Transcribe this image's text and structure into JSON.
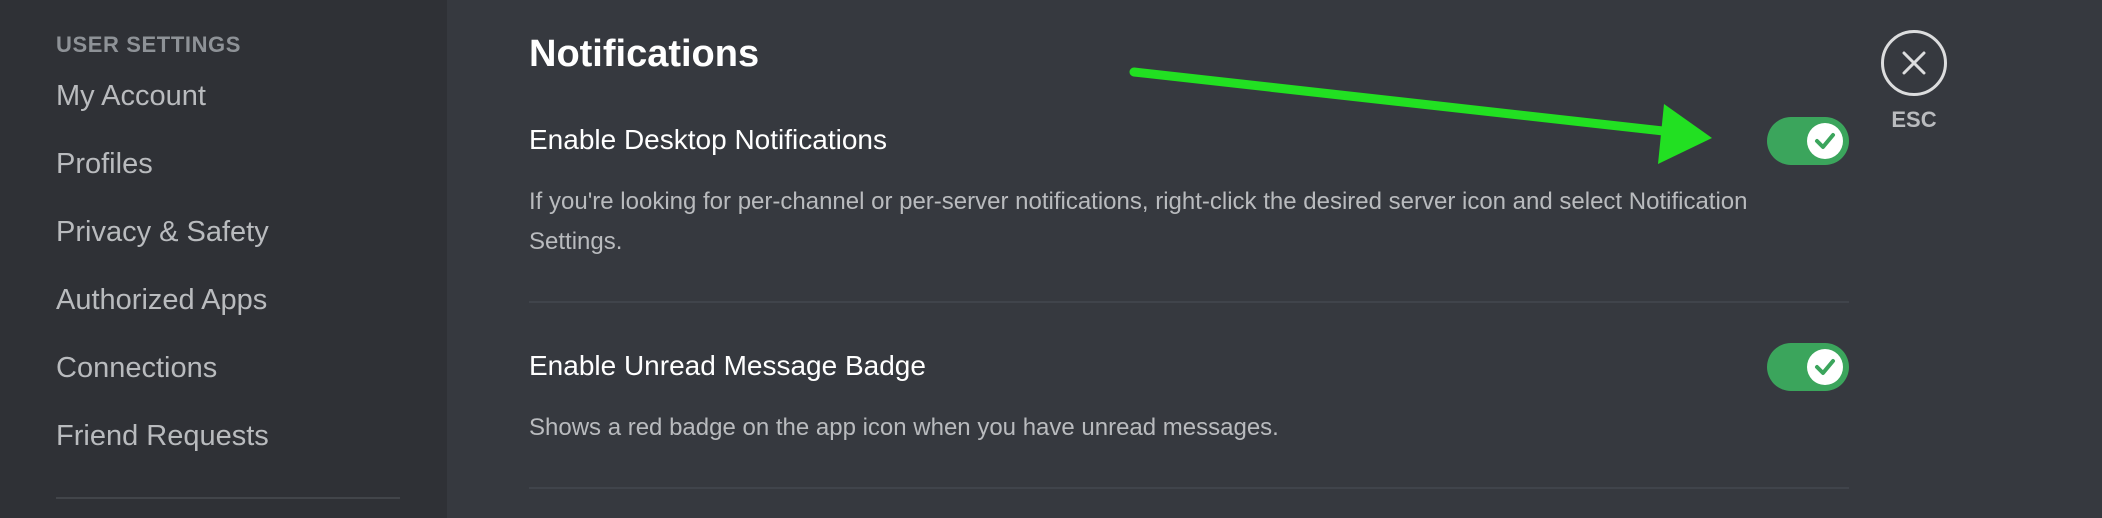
{
  "sidebar": {
    "header": "USER SETTINGS",
    "items": [
      {
        "label": "My Account"
      },
      {
        "label": "Profiles"
      },
      {
        "label": "Privacy & Safety"
      },
      {
        "label": "Authorized Apps"
      },
      {
        "label": "Connections"
      },
      {
        "label": "Friend Requests"
      }
    ]
  },
  "main": {
    "title": "Notifications",
    "settings": [
      {
        "title": "Enable Desktop Notifications",
        "description": "If you're looking for per-channel or per-server notifications, right-click the desired server icon and select Notification Settings.",
        "enabled": true
      },
      {
        "title": "Enable Unread Message Badge",
        "description": "Shows a red badge on the app icon when you have unread messages.",
        "enabled": true
      }
    ]
  },
  "close": {
    "label": "ESC",
    "icon": "close-icon"
  },
  "colors": {
    "toggle_on": "#3ba55c",
    "annotation_arrow": "#22e022",
    "background": "#36393f",
    "sidebar_background": "#2f3136"
  }
}
